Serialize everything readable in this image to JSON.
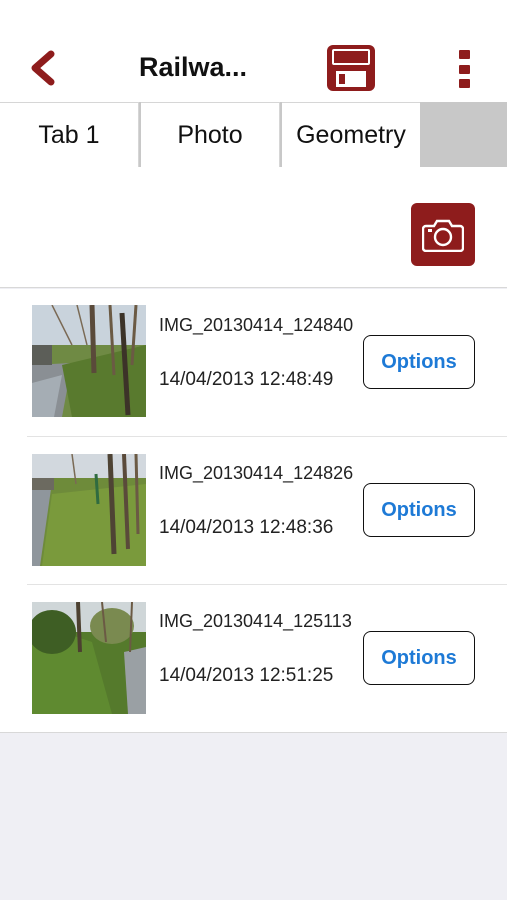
{
  "header": {
    "title": "Railwa...",
    "accent_color": "#8e1c1c",
    "back_icon": "chevron-left-icon",
    "save_icon": "floppy-disk-icon",
    "more_icon": "vertical-ellipsis-icon"
  },
  "tabs": [
    {
      "label": "Tab 1",
      "active": false
    },
    {
      "label": "Photo",
      "active": true
    },
    {
      "label": "Geometry",
      "active": false
    }
  ],
  "actions": {
    "camera_icon": "camera-icon"
  },
  "photos": [
    {
      "filename": "IMG_20130414_124840",
      "datetime": "14/04/2013 12:48:49",
      "options_label": "Options"
    },
    {
      "filename": "IMG_20130414_124826",
      "datetime": "14/04/2013 12:48:36",
      "options_label": "Options"
    },
    {
      "filename": "IMG_20130414_125113",
      "datetime": "14/04/2013 12:51:25",
      "options_label": "Options"
    }
  ]
}
